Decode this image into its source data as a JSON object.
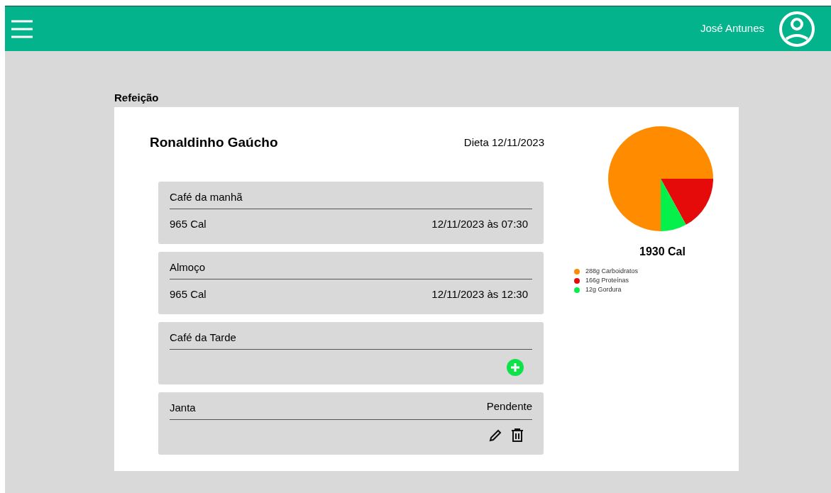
{
  "header": {
    "user_name": "José Antunes"
  },
  "section_title": "Refeição",
  "patient": {
    "name": "Ronaldinho Gaúcho",
    "diet": "Dieta 12/11/2023"
  },
  "meals": [
    {
      "kind": "logged",
      "title": "Café da manhã",
      "calories": "965 Cal",
      "datetime": "12/11/2023 às 07:30"
    },
    {
      "kind": "logged",
      "title": "Almoço",
      "calories": "965 Cal",
      "datetime": "12/11/2023 às 12:30"
    },
    {
      "kind": "empty",
      "title": "Café da Tarde"
    },
    {
      "kind": "pending",
      "title": "Janta",
      "status": "Pendente"
    }
  ],
  "summary": {
    "total": "1930 Cal",
    "legend": [
      {
        "label": "288g Carboidratos",
        "color": "#ff8c00"
      },
      {
        "label": "166g Proteínas",
        "color": "#e60b0b"
      },
      {
        "label": "12g Gordura",
        "color": "#05f04a"
      }
    ]
  }
}
